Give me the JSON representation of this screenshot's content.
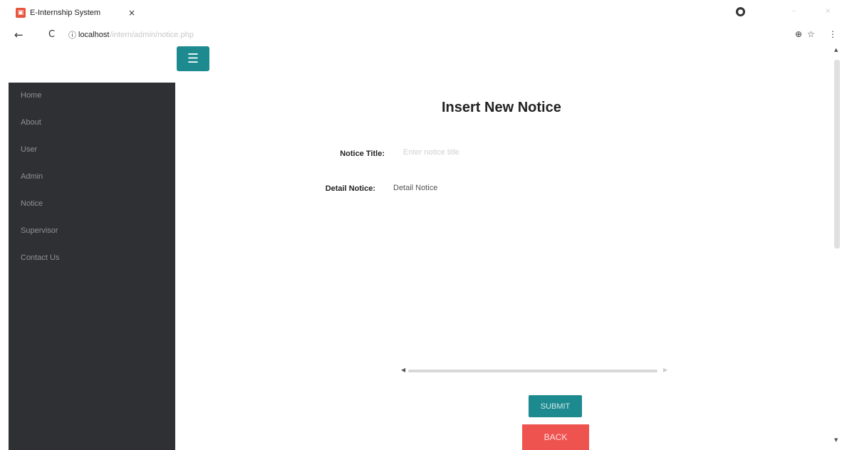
{
  "browser": {
    "tab_title": "E-Internship System",
    "tab_close": "×",
    "url_host": "localhost",
    "url_path": "/intern/admin/notice.php",
    "back_glyph": "←",
    "reload_glyph": "C",
    "info_glyph": "ⓘ",
    "profile_glyph": "●",
    "zoom_glyph": "⊕",
    "star_glyph": "☆",
    "menu_glyph": "⋮",
    "icons": [
      "favicon",
      "close-icon",
      "back-arrow-icon",
      "reload-icon",
      "info-icon",
      "profile-icon",
      "zoom-icon",
      "star-icon",
      "kebab-menu-icon"
    ]
  },
  "page": {
    "menu_toggle_glyph": "☰",
    "sidebar": {
      "items": [
        {
          "label": "Home"
        },
        {
          "label": "About"
        },
        {
          "label": "User"
        },
        {
          "label": "Admin"
        },
        {
          "label": "Notice"
        },
        {
          "label": "Supervisor"
        },
        {
          "label": "Contact Us"
        }
      ]
    },
    "form": {
      "title": "Insert New Notice",
      "notice_title_label": "Notice Title:",
      "notice_title_placeholder": "Enter notice title",
      "detail_label": "Detail Notice:",
      "detail_placeholder": "Detail Notice",
      "submit_label": "SUBMIT",
      "back_label": "BACK"
    }
  },
  "colors": {
    "accent": "#1d8a8f",
    "sidebar_bg": "#2e3033",
    "back_button": "#ef5350"
  }
}
